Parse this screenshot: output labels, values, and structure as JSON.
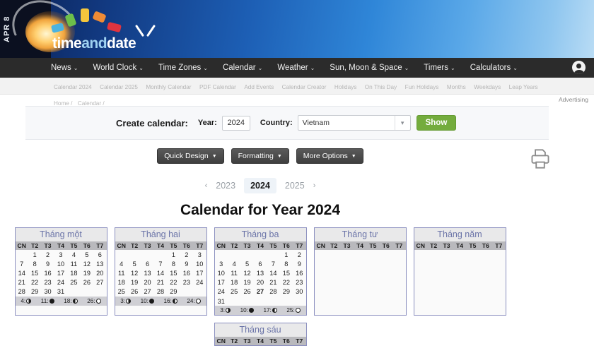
{
  "banner": {
    "date_tab": "APR 8",
    "logo_part1": "time",
    "logo_part2": "and",
    "logo_part3": "date",
    "tile_colors": [
      "#4bb3e0",
      "#6cbf4a",
      "#f5c63c",
      "#ef8b35",
      "#e0343f"
    ]
  },
  "mainnav": {
    "items": [
      {
        "label": "News",
        "caret": "⌄"
      },
      {
        "label": "World Clock",
        "caret": "⌄"
      },
      {
        "label": "Time Zones",
        "caret": "⌄"
      },
      {
        "label": "Calendar",
        "caret": "⌄"
      },
      {
        "label": "Weather",
        "caret": "⌄"
      },
      {
        "label": "Sun, Moon & Space",
        "caret": "⌄"
      },
      {
        "label": "Timers",
        "caret": "⌄"
      },
      {
        "label": "Calculators",
        "caret": "⌄"
      }
    ],
    "account_icon": "account-icon"
  },
  "subnav": {
    "items": [
      "Calendar 2024",
      "Calendar 2025",
      "Monthly Calendar",
      "PDF Calendar",
      "Add Events",
      "Calendar Creator",
      "Holidays",
      "On This Day",
      "Fun Holidays",
      "Months",
      "Weekdays",
      "Leap Years"
    ]
  },
  "breadcrumb": {
    "items": [
      "Home /",
      "Calendar /"
    ]
  },
  "advertising": {
    "label": "Advertising"
  },
  "create_form": {
    "title": "Create calendar:",
    "year_label": "Year:",
    "year_value": "2024",
    "country_label": "Country:",
    "country_value": "Vietnam",
    "show_label": "Show",
    "accent_color": "#74ac3d"
  },
  "option_buttons": [
    {
      "label": "Quick Design",
      "caret": "▼"
    },
    {
      "label": "Formatting",
      "caret": "▼"
    },
    {
      "label": "More Options",
      "caret": "▼"
    }
  ],
  "print_icon": "printer-icon",
  "year_nav": {
    "prev_chevron": "‹",
    "next_chevron": "›",
    "prev_year": "2023",
    "current_year": "2024",
    "next_year": "2025"
  },
  "page_title": "Calendar for Year 2024",
  "weekday_headers": [
    "CN",
    "T2",
    "T3",
    "T4",
    "T5",
    "T6",
    "T7"
  ],
  "months": [
    {
      "name": "Tháng một",
      "weeks": [
        [
          null,
          {
            "d": "1",
            "t": "hol"
          },
          {
            "d": "2"
          },
          {
            "d": "3"
          },
          {
            "d": "4"
          },
          {
            "d": "5"
          },
          {
            "d": "6",
            "t": "sat"
          }
        ],
        [
          {
            "d": "7",
            "t": "sun"
          },
          {
            "d": "8"
          },
          {
            "d": "9"
          },
          {
            "d": "10"
          },
          {
            "d": "11"
          },
          {
            "d": "12"
          },
          {
            "d": "13",
            "t": "sat"
          }
        ],
        [
          {
            "d": "14",
            "t": "sun"
          },
          {
            "d": "15"
          },
          {
            "d": "16"
          },
          {
            "d": "17"
          },
          {
            "d": "18"
          },
          {
            "d": "19"
          },
          {
            "d": "20",
            "t": "sat"
          }
        ],
        [
          {
            "d": "21",
            "t": "sun"
          },
          {
            "d": "22"
          },
          {
            "d": "23"
          },
          {
            "d": "24"
          },
          {
            "d": "25"
          },
          {
            "d": "26"
          },
          {
            "d": "27",
            "t": "sat"
          }
        ],
        [
          {
            "d": "28",
            "t": "sun"
          },
          {
            "d": "29"
          },
          {
            "d": "30"
          },
          {
            "d": "31"
          },
          null,
          null,
          null
        ]
      ],
      "moon": [
        {
          "day": "4:",
          "phase": "fq"
        },
        {
          "day": "11:",
          "phase": "new"
        },
        {
          "day": "18:",
          "phase": "lq"
        },
        {
          "day": "26:",
          "phase": "full"
        }
      ]
    },
    {
      "name": "Tháng hai",
      "weeks": [
        [
          null,
          null,
          null,
          null,
          {
            "d": "1"
          },
          {
            "d": "2"
          },
          {
            "d": "3",
            "t": "sat"
          }
        ],
        [
          {
            "d": "4",
            "t": "sun"
          },
          {
            "d": "5"
          },
          {
            "d": "6"
          },
          {
            "d": "7"
          },
          {
            "d": "8",
            "t": "hol"
          },
          {
            "d": "9",
            "t": "hol"
          },
          {
            "d": "10",
            "t": "hol"
          }
        ],
        [
          {
            "d": "11",
            "t": "sun"
          },
          {
            "d": "12",
            "t": "hol"
          },
          {
            "d": "13",
            "t": "hol"
          },
          {
            "d": "14",
            "t": "hol"
          },
          {
            "d": "15"
          },
          {
            "d": "16"
          },
          {
            "d": "17",
            "t": "sat"
          }
        ],
        [
          {
            "d": "18",
            "t": "sun"
          },
          {
            "d": "19"
          },
          {
            "d": "20"
          },
          {
            "d": "21"
          },
          {
            "d": "22"
          },
          {
            "d": "23"
          },
          {
            "d": "24",
            "t": "sat"
          }
        ],
        [
          {
            "d": "25",
            "t": "sun"
          },
          {
            "d": "26"
          },
          {
            "d": "27"
          },
          {
            "d": "28"
          },
          {
            "d": "29"
          },
          null,
          null
        ]
      ],
      "moon": [
        {
          "day": "3:",
          "phase": "fq"
        },
        {
          "day": "10:",
          "phase": "new"
        },
        {
          "day": "16:",
          "phase": "lq"
        },
        {
          "day": "24:",
          "phase": "full"
        }
      ]
    },
    {
      "name": "Tháng ba",
      "weeks": [
        [
          null,
          null,
          null,
          null,
          null,
          {
            "d": "1"
          },
          {
            "d": "2",
            "t": "sat"
          }
        ],
        [
          {
            "d": "3",
            "t": "sun"
          },
          {
            "d": "4"
          },
          {
            "d": "5"
          },
          {
            "d": "6"
          },
          {
            "d": "7"
          },
          {
            "d": "8"
          },
          {
            "d": "9",
            "t": "sat"
          }
        ],
        [
          {
            "d": "10",
            "t": "sun"
          },
          {
            "d": "11"
          },
          {
            "d": "12"
          },
          {
            "d": "13"
          },
          {
            "d": "14"
          },
          {
            "d": "15"
          },
          {
            "d": "16",
            "t": "sat"
          }
        ],
        [
          {
            "d": "17",
            "t": "sun"
          },
          {
            "d": "18"
          },
          {
            "d": "19"
          },
          {
            "d": "20"
          },
          {
            "d": "21"
          },
          {
            "d": "22"
          },
          {
            "d": "23",
            "t": "sat"
          }
        ],
        [
          {
            "d": "24",
            "t": "sun"
          },
          {
            "d": "25"
          },
          {
            "d": "26"
          },
          {
            "d": "27",
            "t": "today"
          },
          {
            "d": "28"
          },
          {
            "d": "29"
          },
          {
            "d": "30",
            "t": "sat"
          }
        ],
        [
          {
            "d": "31",
            "t": "sun"
          },
          null,
          null,
          null,
          null,
          null,
          null
        ]
      ],
      "moon": [
        {
          "day": "3:",
          "phase": "fq"
        },
        {
          "day": "10:",
          "phase": "new"
        },
        {
          "day": "17:",
          "phase": "lq"
        },
        {
          "day": "25:",
          "phase": "full"
        }
      ]
    },
    {
      "name": "Tháng tư",
      "weeks": [],
      "moon": []
    },
    {
      "name": "Tháng năm",
      "weeks": [],
      "moon": []
    },
    {
      "name": "Tháng sáu",
      "weeks": [],
      "moon": []
    }
  ]
}
